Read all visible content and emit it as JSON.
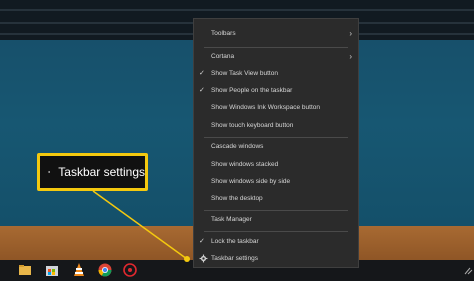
{
  "callout": {
    "label": "Taskbar settings",
    "icon": "gear-icon",
    "accent": "#f4c90f"
  },
  "menu": {
    "items": [
      {
        "label": "Toolbars",
        "checked": false,
        "submenu": true
      },
      {
        "label": "Cortana",
        "checked": false,
        "submenu": true
      },
      {
        "label": "Show Task View button",
        "checked": true,
        "submenu": false
      },
      {
        "label": "Show People on the taskbar",
        "checked": true,
        "submenu": false
      },
      {
        "label": "Show Windows Ink Workspace button",
        "checked": false,
        "submenu": false
      },
      {
        "label": "Show touch keyboard button",
        "checked": false,
        "submenu": false
      },
      {
        "label": "Cascade windows",
        "checked": false,
        "submenu": false
      },
      {
        "label": "Show windows stacked",
        "checked": false,
        "submenu": false
      },
      {
        "label": "Show windows side by side",
        "checked": false,
        "submenu": false
      },
      {
        "label": "Show the desktop",
        "checked": false,
        "submenu": false
      },
      {
        "label": "Task Manager",
        "checked": false,
        "submenu": false
      },
      {
        "label": "Lock the taskbar",
        "checked": true,
        "submenu": false
      },
      {
        "label": "Taskbar settings",
        "checked": false,
        "submenu": false,
        "icon": "gear-icon"
      }
    ],
    "check_glyph": "✓",
    "submenu_glyph": "›"
  },
  "taskbar": {
    "icons": [
      "file-explorer-icon",
      "store-icon",
      "vlc-icon",
      "chrome-icon",
      "app-icon"
    ]
  }
}
